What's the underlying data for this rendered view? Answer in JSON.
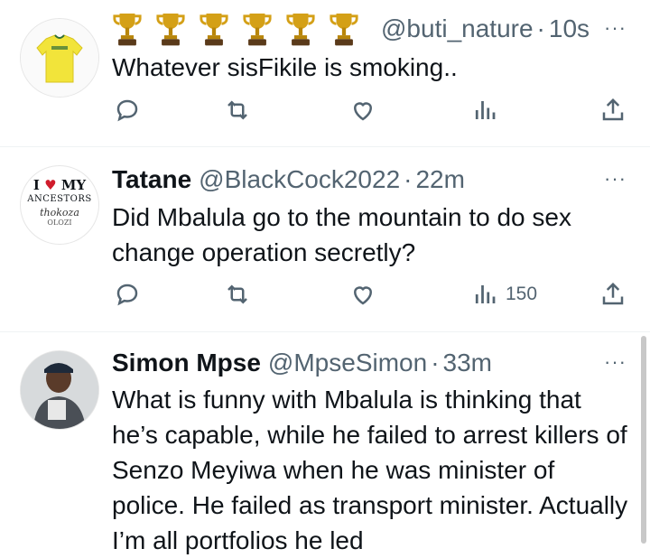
{
  "tweets": [
    {
      "name": "",
      "handle": "@buti_nature",
      "time": "10s",
      "trophy_count": 6,
      "text": "Whatever sisFikile is smoking..",
      "views": "",
      "more": "···"
    },
    {
      "name": "Tatane",
      "handle": "@BlackCock2022",
      "time": "22m",
      "avatar_lines": [
        "I",
        "MY",
        "ANCESTORS",
        "thokoza",
        "OLOZI"
      ],
      "text": "Did Mbalula go to the mountain to do sex change operation secretly?",
      "views": "150",
      "more": "···"
    },
    {
      "name": "Simon Mpse",
      "handle": "@MpseSimon",
      "time": "33m",
      "text": "What is funny with Mbalula is thinking that he’s capable, while he failed to arrest killers of Senzo Meyiwa when he was minister of police. He failed as transport minister. Actually I’m all portfolios he led",
      "more": "···"
    }
  ],
  "separator": "·",
  "colors": {
    "secondary": "#536471",
    "text": "#0f1419",
    "trophy": "#d4a017",
    "jersey": "#f2e43a"
  },
  "icons": [
    "reply-icon",
    "retweet-icon",
    "like-icon",
    "views-icon",
    "share-icon",
    "more-icon",
    "trophy-icon"
  ]
}
